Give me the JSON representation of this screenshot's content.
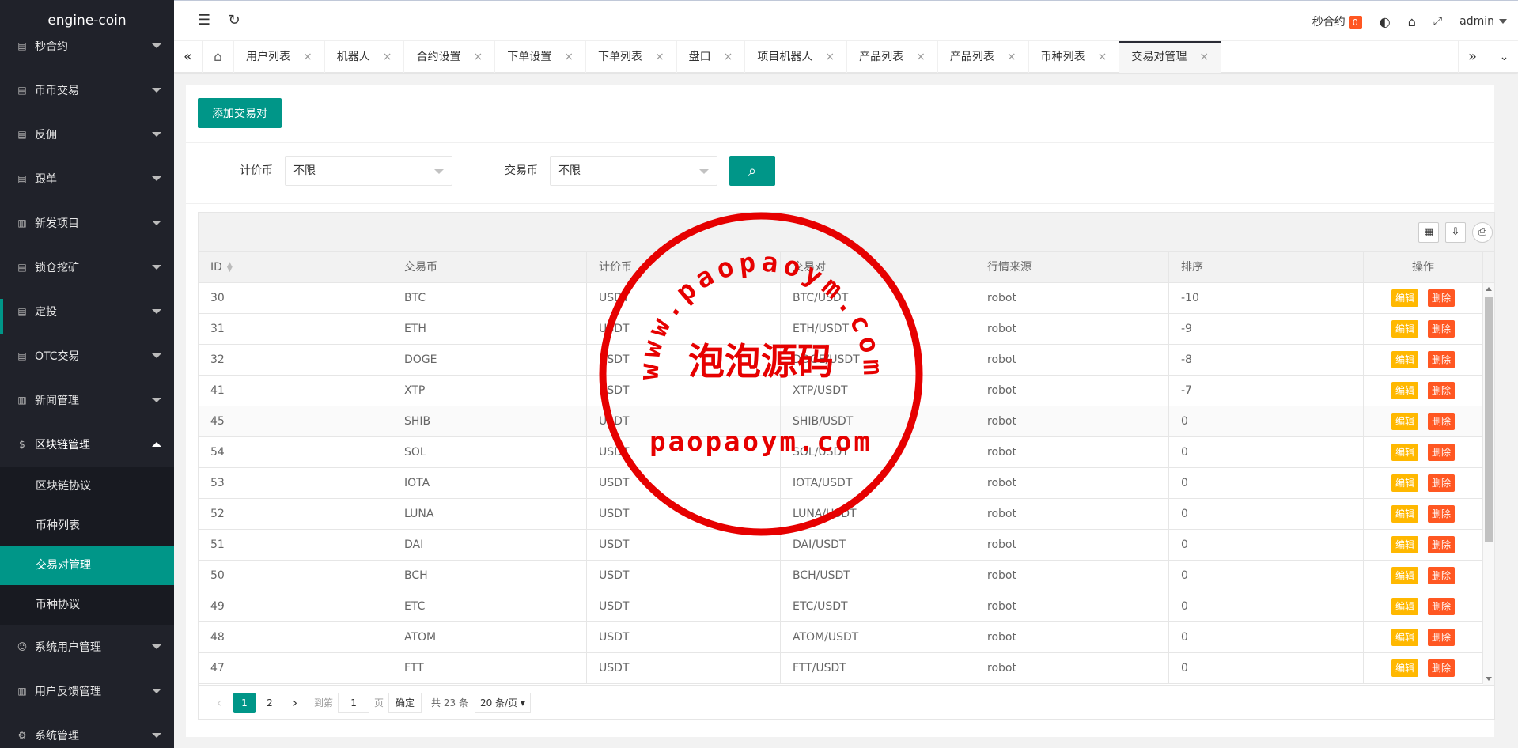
{
  "app": {
    "logo": "engine-coin"
  },
  "sidebar": {
    "items": [
      {
        "label": "秒合约",
        "icon": "doc-icon"
      },
      {
        "label": "币币交易",
        "icon": "doc-icon"
      },
      {
        "label": "反佣",
        "icon": "doc-icon"
      },
      {
        "label": "跟单",
        "icon": "doc-icon"
      },
      {
        "label": "新发项目",
        "icon": "news-icon"
      },
      {
        "label": "锁仓挖矿",
        "icon": "doc-icon"
      },
      {
        "label": "定投",
        "icon": "doc-icon"
      },
      {
        "label": "OTC交易",
        "icon": "doc-icon"
      },
      {
        "label": "新闻管理",
        "icon": "news-icon"
      },
      {
        "label": "区块链管理",
        "icon": "dollar-icon"
      },
      {
        "label": "系统用户管理",
        "icon": "user-icon"
      },
      {
        "label": "用户反馈管理",
        "icon": "news-icon"
      },
      {
        "label": "系统管理",
        "icon": "gear-icon"
      }
    ],
    "subitems": [
      "区块链协议",
      "币种列表",
      "交易对管理",
      "币种协议"
    ]
  },
  "header": {
    "contract_label": "秒合约",
    "contract_badge": "0",
    "user": "admin"
  },
  "tabs": [
    "用户列表",
    "机器人",
    "合约设置",
    "下单设置",
    "下单列表",
    "盘口",
    "项目机器人",
    "产品列表",
    "产品列表",
    "币种列表",
    "交易对管理"
  ],
  "content": {
    "add_button": "添加交易对",
    "filters": {
      "quote_label": "计价币",
      "quote_value": "不限",
      "coin_label": "交易币",
      "coin_value": "不限"
    }
  },
  "table": {
    "columns": [
      "ID",
      "交易币",
      "计价币",
      "交易对",
      "行情来源",
      "排序",
      "操作"
    ],
    "edit_label": "编辑",
    "delete_label": "删除",
    "rows": [
      [
        "30",
        "BTC",
        "USDT",
        "BTC/USDT",
        "robot",
        "-10"
      ],
      [
        "31",
        "ETH",
        "USDT",
        "ETH/USDT",
        "robot",
        "-9"
      ],
      [
        "32",
        "DOGE",
        "USDT",
        "DOGE/USDT",
        "robot",
        "-8"
      ],
      [
        "41",
        "XTP",
        "USDT",
        "XTP/USDT",
        "robot",
        "-7"
      ],
      [
        "45",
        "SHIB",
        "USDT",
        "SHIB/USDT",
        "robot",
        "0"
      ],
      [
        "54",
        "SOL",
        "USDT",
        "SOL/USDT",
        "robot",
        "0"
      ],
      [
        "53",
        "IOTA",
        "USDT",
        "IOTA/USDT",
        "robot",
        "0"
      ],
      [
        "52",
        "LUNA",
        "USDT",
        "LUNA/USDT",
        "robot",
        "0"
      ],
      [
        "51",
        "DAI",
        "USDT",
        "DAI/USDT",
        "robot",
        "0"
      ],
      [
        "50",
        "BCH",
        "USDT",
        "BCH/USDT",
        "robot",
        "0"
      ],
      [
        "49",
        "ETC",
        "USDT",
        "ETC/USDT",
        "robot",
        "0"
      ],
      [
        "48",
        "ATOM",
        "USDT",
        "ATOM/USDT",
        "robot",
        "0"
      ],
      [
        "47",
        "FTT",
        "USDT",
        "FTT/USDT",
        "robot",
        "0"
      ]
    ]
  },
  "pager": {
    "pages": [
      "1",
      "2"
    ],
    "current": "1",
    "goto_label": "到第",
    "goto_value": "1",
    "page_unit": "页",
    "confirm": "确定",
    "total": "共 23 条",
    "size": "20 条/页"
  },
  "watermark": {
    "arc_text": "www.paopaoym.com",
    "center_text": "泡泡源码",
    "bottom_text": "paopaoym.com",
    "color": "#e60000"
  }
}
